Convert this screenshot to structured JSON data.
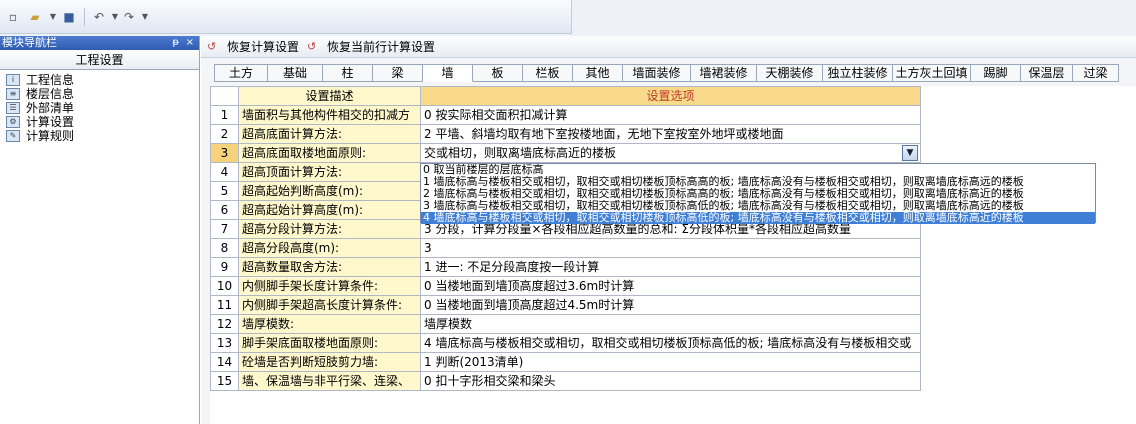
{
  "toolbar": {
    "icons": [
      "new-file-icon",
      "open-folder-icon",
      "save-icon",
      "undo-icon",
      "redo-icon"
    ]
  },
  "nav": {
    "title": "模块导航栏",
    "pin": "ᵽ",
    "close": "×",
    "section": "工程设置",
    "items": [
      {
        "label": "工程信息",
        "icon": "project-info-icon"
      },
      {
        "label": "楼层信息",
        "icon": "floor-info-icon"
      },
      {
        "label": "外部清单",
        "icon": "external-list-icon"
      },
      {
        "label": "计算设置",
        "icon": "calc-settings-icon"
      },
      {
        "label": "计算规则",
        "icon": "calc-rules-icon"
      }
    ]
  },
  "commands": {
    "restore_calc": "恢复计算设置",
    "restore_row": "恢复当前行计算设置"
  },
  "tabs": [
    {
      "label": "土方"
    },
    {
      "label": "基础"
    },
    {
      "label": "柱"
    },
    {
      "label": "梁"
    },
    {
      "label": "墙"
    },
    {
      "label": "板"
    },
    {
      "label": "栏板"
    },
    {
      "label": "其他"
    },
    {
      "label": "墙面装修"
    },
    {
      "label": "墙裙装修"
    },
    {
      "label": "天棚装修"
    },
    {
      "label": "独立柱装修"
    },
    {
      "label": "土方灰土回填"
    },
    {
      "label": "踢脚"
    },
    {
      "label": "保温层"
    },
    {
      "label": "过梁"
    }
  ],
  "grid": {
    "header_desc": "设置描述",
    "header_opt": "设置选项",
    "rows": [
      {
        "num": "1",
        "desc": "墙面积与其他构件相交的扣减方",
        "opt": "0 按实际相交面积扣减计算"
      },
      {
        "num": "2",
        "desc": "超高底面计算方法:",
        "opt": "2 平墙、斜墙均取有地下室按楼地面，无地下室按室外地坪或楼地面"
      },
      {
        "num": "3",
        "desc": "超高底面取楼地面原则:",
        "opt": "交或相切，则取离墙底标高近的楼板"
      },
      {
        "num": "4",
        "desc": "超高顶面计算方法:",
        "opt": ""
      },
      {
        "num": "5",
        "desc": "超高起始判断高度(m):",
        "opt": ""
      },
      {
        "num": "6",
        "desc": "超高起始计算高度(m):",
        "opt": ""
      },
      {
        "num": "7",
        "desc": "超高分段计算方法:",
        "opt": "3 分段，计算分段量×各段相应超高数量的总和: Σ分段体积量*各段相应超高数量"
      },
      {
        "num": "8",
        "desc": "超高分段高度(m):",
        "opt": "3"
      },
      {
        "num": "9",
        "desc": "超高数量取舍方法:",
        "opt": "1 进一: 不足分段高度按一段计算"
      },
      {
        "num": "10",
        "desc": "内侧脚手架长度计算条件:",
        "opt": "0 当楼地面到墙顶高度超过3.6m时计算"
      },
      {
        "num": "11",
        "desc": "内侧脚手架超高长度计算条件:",
        "opt": "0 当楼地面到墙顶高度超过4.5m时计算"
      },
      {
        "num": "12",
        "desc": "墙厚模数:",
        "opt": "墙厚模数"
      },
      {
        "num": "13",
        "desc": "脚手架底面取楼地面原则:",
        "opt": "4 墙底标高与楼板相交或相切，取相交或相切楼板顶标高低的板; 墙底标高没有与楼板相交或"
      },
      {
        "num": "14",
        "desc": "砼墙是否判断短肢剪力墙:",
        "opt": "1 判断(2013清单)"
      },
      {
        "num": "15",
        "desc": "墙、保温墙与非平行梁、连梁、",
        "opt": "0 扣十字形相交梁和梁头"
      }
    ]
  },
  "dropdown": {
    "options": [
      "0 取当前楼层的层底标高",
      "1 墙底标高与楼板相交或相切，取相交或相切楼板顶标高高的板; 墙底标高没有与楼板相交或相切，则取离墙底标高远的楼板",
      "2 墙底标高与楼板相交或相切，取相交或相切楼板顶标高高的板; 墙底标高没有与楼板相交或相切，则取离墙底标高近的楼板",
      "3 墙底标高与楼板相交或相切，取相交或相切楼板顶标高低的板; 墙底标高没有与楼板相交或相切，则取离墙底标高远的楼板",
      "4 墙底标高与楼板相交或相切，取相交或相切楼板顶标高低的板; 墙底标高没有与楼板相交或相切，则取离墙底标高近的楼板"
    ],
    "highlighted": 4
  }
}
